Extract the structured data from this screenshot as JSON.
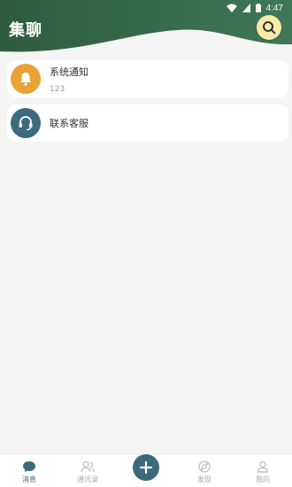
{
  "status_bar": {
    "time": "4:47"
  },
  "header": {
    "title": "集聊"
  },
  "conversations": [
    {
      "name": "系统通知",
      "preview": "123",
      "icon": "bell-icon",
      "color": "#e8a236"
    },
    {
      "name": "联系客服",
      "preview": "",
      "icon": "headset-icon",
      "color": "#3b6b7c"
    }
  ],
  "bottom_nav": {
    "messages": "消息",
    "contacts": "通讯录",
    "discover": "发现",
    "mine": "我的"
  },
  "colors": {
    "header_dark": "#2f5a3d",
    "accent": "#3a6a7b",
    "search_bg": "#f7e9a6"
  }
}
